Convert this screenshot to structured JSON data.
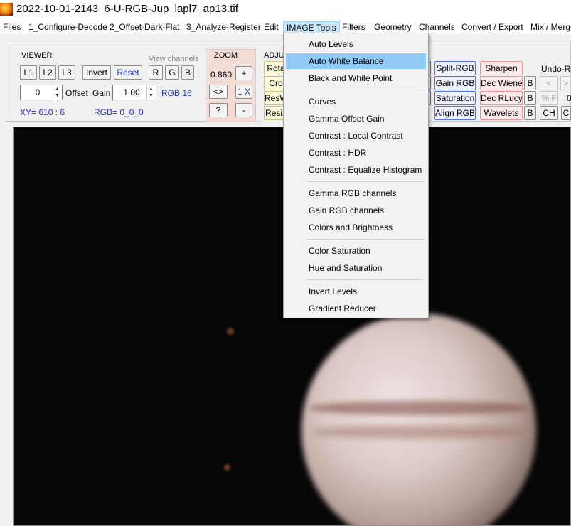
{
  "window": {
    "title": "2022-10-01-2143_6-U-RGB-Jup_lapl7_ap13.tif",
    "icon": "app-icon"
  },
  "menubar": {
    "items": [
      "Files",
      "1_Configure-Decode",
      "2_Offset-Dark-Flat",
      "3_Analyze-Register",
      "Edit",
      "IMAGE Tools",
      "Filters",
      "Geometry",
      "Channels",
      "Convert / Export",
      "Mix / Merge"
    ],
    "active": "IMAGE Tools"
  },
  "viewer": {
    "label": "VIEWER",
    "view_channels_label": "View channels",
    "btn_l1": "L1",
    "btn_l2": "L2",
    "btn_l3": "L3",
    "btn_invert": "Invert",
    "btn_reset": "Reset",
    "btn_r": "R",
    "btn_g": "G",
    "btn_b": "B",
    "offset_value": "0",
    "offset_label": "Offset",
    "gain_label": "Gain",
    "gain_value": "1.00",
    "rgb_mode": "RGB 16",
    "xy_readout": "XY=  610 : 6",
    "rgb_readout": "RGB=  0_0_0"
  },
  "zoom": {
    "label": "ZOOM",
    "value": "0.860",
    "btn_plus": "+",
    "btn_fit": "<>",
    "btn_1x": "1 X",
    "btn_help": "?",
    "btn_minus": "-"
  },
  "adjust": {
    "label": "ADJUS",
    "btn_rotate": "Rota",
    "btn_crop": "Cro",
    "btn_resw": "ResW",
    "btn_resize": "Resiz"
  },
  "tools_right": {
    "split_rgb": "Split-RGB",
    "gain_rgb": "Gain RGB",
    "saturation": "Saturation",
    "align_rgb": "Align RGB",
    "sharpen": "Sharpen",
    "dec_wiener": "Dec Wiener",
    "dec_rlucy": "Dec RLucy",
    "wavelets": "Wavelets",
    "b1": "B",
    "b2": "B",
    "b3": "B",
    "undo_label": "Undo-Re",
    "undo": "<",
    "redo": ">",
    "pct_f": "% F",
    "ch": "CH",
    "c": "C",
    "zero": "0"
  },
  "dropdown": {
    "items": [
      "Auto Levels",
      "Auto White Balance",
      "Black and  White Point",
      "Curves",
      "Gamma Offset Gain",
      "Contrast : Local Contrast",
      "Contrast : HDR",
      "Contrast : Equalize Histogram",
      "Gamma RGB channels",
      "Gain RGB channels",
      "Colors and Brightness",
      "Color Saturation",
      "Hue and Saturation",
      "Invert Levels",
      "Gradient Reducer"
    ],
    "highlighted": "Auto White Balance"
  }
}
